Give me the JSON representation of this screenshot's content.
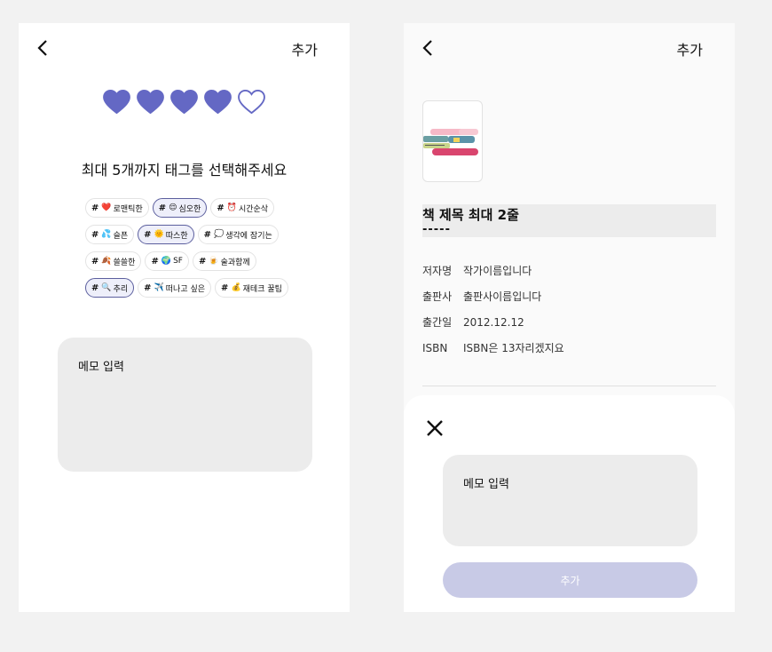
{
  "left": {
    "add_label": "추가",
    "rating": 4,
    "rating_max": 5,
    "prompt": "최대 5개까지 태그를 선택해주세요",
    "tags": [
      {
        "emoji": "❤️",
        "label": "로맨틱한",
        "selected": false
      },
      {
        "emoji": "😌",
        "label": "심오한",
        "selected": true
      },
      {
        "emoji": "⏰",
        "label": "시간순삭",
        "selected": false
      },
      {
        "emoji": "💦",
        "label": "슬픈",
        "selected": false
      },
      {
        "emoji": "🌞",
        "label": "따스한",
        "selected": true
      },
      {
        "emoji": "💭",
        "label": "생각에 잠기는",
        "selected": false
      },
      {
        "emoji": "🍂",
        "label": "쓸쓸한",
        "selected": false
      },
      {
        "emoji": "🌍",
        "label": "SF",
        "selected": false
      },
      {
        "emoji": "🍺",
        "label": "술과함께",
        "selected": false
      },
      {
        "emoji": "🔍",
        "label": "추리",
        "selected": true
      },
      {
        "emoji": "✈️",
        "label": "떠나고 싶은",
        "selected": false
      },
      {
        "emoji": "💰",
        "label": "재테크 꿀팁",
        "selected": false
      }
    ],
    "memo_placeholder": "메모 입력"
  },
  "right": {
    "add_label": "추가",
    "book_title": "책 제목 최대 2줄",
    "book_title_line2": "-----",
    "author_label": "저자명",
    "author_value": "작가이름입니다",
    "publisher_label": "출판사",
    "publisher_value": "출판사이름입니다",
    "pubdate_label": "출간일",
    "pubdate_value": "2012.12.12",
    "isbn_label": "ISBN",
    "isbn_value": "ISBN은 13자리겠지요",
    "sheet_memo_placeholder": "메모 입력",
    "submit_label": "추가"
  },
  "colors": {
    "accent": "#6468c4",
    "tag_selected_border": "#5c5f9e",
    "submit_disabled": "#c8cae6"
  }
}
